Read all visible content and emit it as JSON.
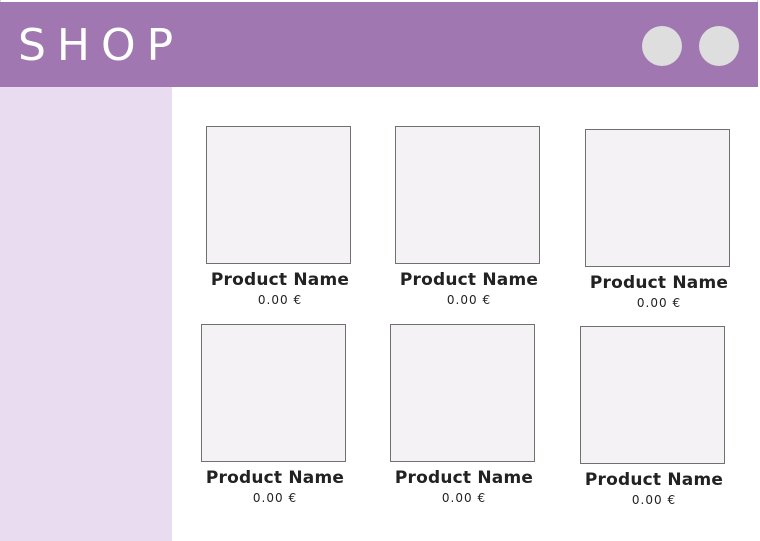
{
  "header": {
    "logo_text": "SHOP",
    "icons": [
      "circle-icon",
      "circle-icon"
    ],
    "background_color": "#a077b0"
  },
  "sidebar": {
    "background_color": "#eadcf0"
  },
  "products": [
    {
      "name": "Product Name",
      "price": "0.00 €"
    },
    {
      "name": "Product Name",
      "price": "0.00 €"
    },
    {
      "name": "Product Name",
      "price": "0.00 €"
    },
    {
      "name": "Product Name",
      "price": "0.00 €"
    },
    {
      "name": "Product Name",
      "price": "0.00 €"
    },
    {
      "name": "Product Name",
      "price": "0.00 €"
    }
  ]
}
